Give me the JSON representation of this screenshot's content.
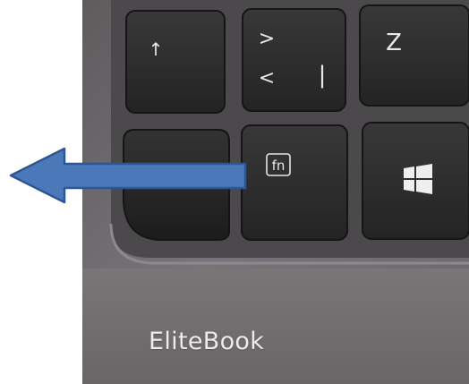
{
  "keys": {
    "up_arrow": "↑",
    "greater_than": ">",
    "less_than": "<",
    "pipe": "|",
    "z": "Z",
    "fn": "fn"
  },
  "icons": {
    "up_arrow": "up-arrow-icon",
    "windows_logo": "windows-logo-icon",
    "pointer_arrow": "left-arrow-icon"
  },
  "brand": {
    "name": "EliteBook"
  },
  "colors": {
    "chassis": "#6f6c6d",
    "key": "#2b2b2b",
    "arrow_fill": "#4a78b8",
    "arrow_stroke": "#2f5690"
  }
}
